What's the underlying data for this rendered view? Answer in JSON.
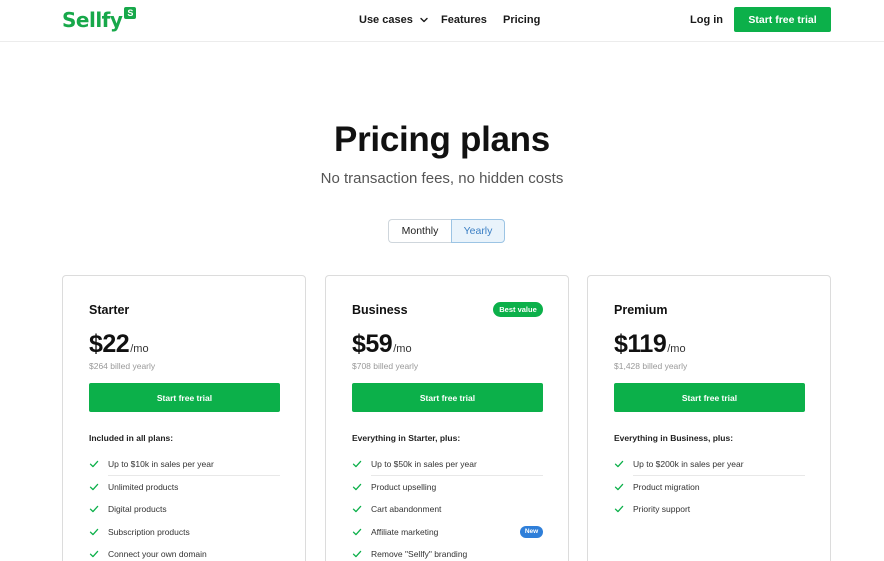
{
  "header": {
    "logo_text": "Sellfy",
    "logo_badge": "S",
    "nav": {
      "use_cases": "Use cases",
      "features": "Features",
      "pricing": "Pricing",
      "login": "Log in"
    },
    "cta": "Start free trial"
  },
  "hero": {
    "title": "Pricing plans",
    "subtitle": "No transaction fees, no hidden costs"
  },
  "billing_toggle": {
    "options": [
      "Monthly",
      "Yearly"
    ],
    "selected": "Yearly"
  },
  "colors": {
    "brand_green": "#0cb04a",
    "toggle_selected_bg": "#e9f3fb",
    "new_badge_blue": "#2f7fd9"
  },
  "plans": [
    {
      "name": "Starter",
      "price": "$22",
      "unit": "/mo",
      "billed": "$264 billed yearly",
      "cta": "Start free trial",
      "features_heading": "Included in all plans:",
      "features": [
        "Up to $10k in sales per year",
        "Unlimited products",
        "Digital products",
        "Subscription products",
        "Connect your own domain"
      ]
    },
    {
      "name": "Business",
      "badge": "Best value",
      "price": "$59",
      "unit": "/mo",
      "billed": "$708 billed yearly",
      "cta": "Start free trial",
      "features_heading": "Everything in Starter, plus:",
      "features": [
        "Up to $50k in sales per year",
        "Product upselling",
        "Cart abandonment",
        "Affiliate marketing",
        "Remove \"Sellfy\" branding"
      ],
      "feature_badge": "New"
    },
    {
      "name": "Premium",
      "price": "$119",
      "unit": "/mo",
      "billed": "$1,428 billed yearly",
      "cta": "Start free trial",
      "features_heading": "Everything in Business, plus:",
      "features": [
        "Up to $200k in sales per year",
        "Product migration",
        "Priority support"
      ]
    }
  ]
}
